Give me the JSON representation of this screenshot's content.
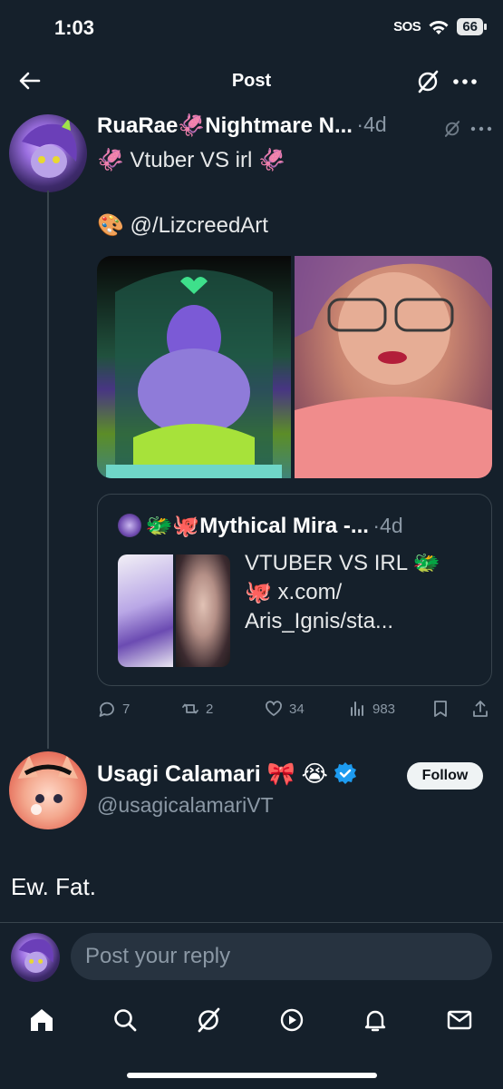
{
  "status_bar": {
    "time": "1:03",
    "sos": "SOS",
    "battery": "66"
  },
  "header": {
    "title": "Post"
  },
  "post": {
    "author_name": "RuaRae🦑Nightmare N...",
    "meta": "·4d",
    "line1": "🦑 Vtuber VS irl 🦑",
    "line2": "🎨 @/LizcreedArt",
    "quote": {
      "author_name": "🐲🐙Mythical Mira -...",
      "meta": "·4d",
      "text_line1": "VTUBER VS IRL 🐲",
      "text_line2": "🐙 x.com/",
      "text_line3": "Aris_Ignis/sta..."
    },
    "actions": {
      "replies": "7",
      "reposts": "2",
      "likes": "34",
      "views": "983"
    }
  },
  "reply": {
    "author_name": "Usagi Calamari 🎀 😭",
    "handle": "@usagicalamariVT",
    "follow_label": "Follow",
    "text": "Ew. Fat."
  },
  "composer": {
    "placeholder": "Post your reply"
  },
  "colors": {
    "background": "#15202b",
    "accent": "#1d9bf0",
    "muted": "#8b98a5",
    "border": "#38444d"
  }
}
